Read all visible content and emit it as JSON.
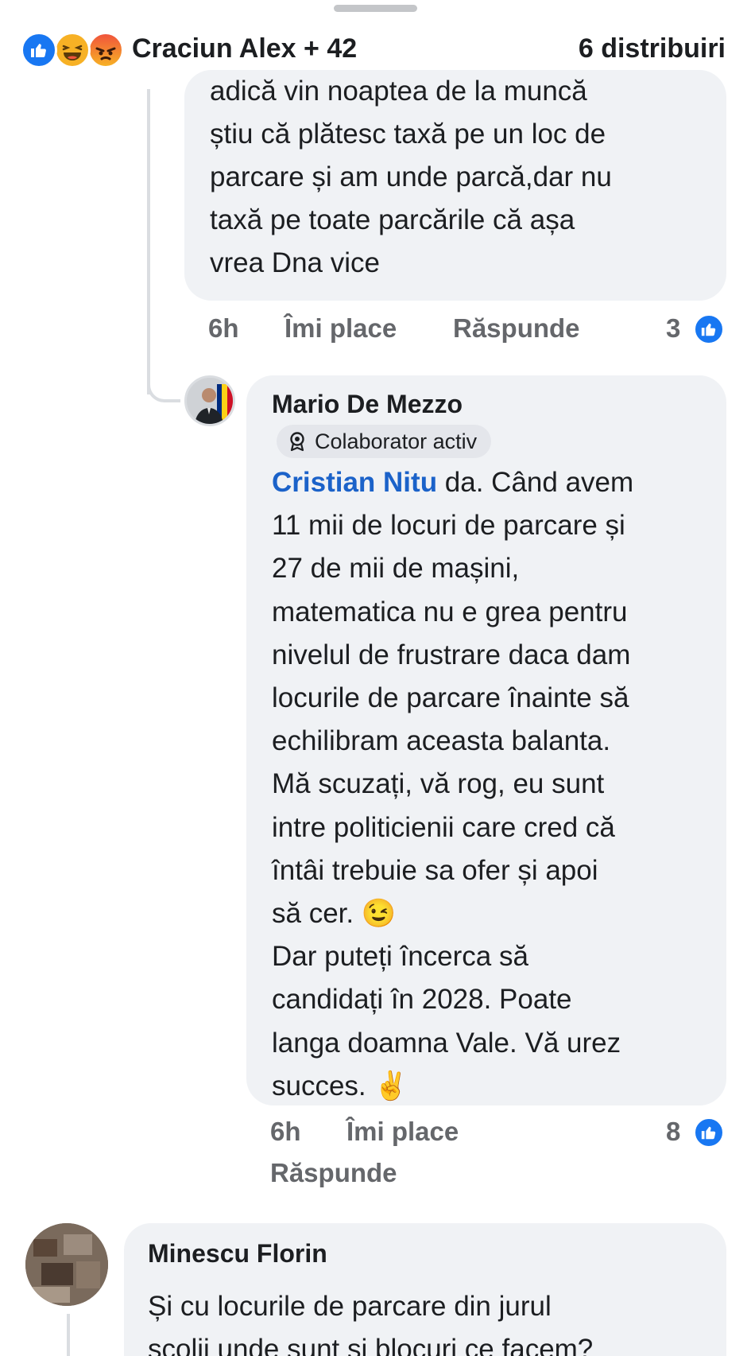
{
  "header": {
    "reaction_names": "Craciun Alex + 42",
    "shares": "6 distribuiri",
    "reaction_icons": [
      "like-icon",
      "haha-icon",
      "angry-icon"
    ],
    "colors": {
      "like": "#1877f2",
      "haha": "#f7b125",
      "angry": "#f0543c"
    }
  },
  "comment1": {
    "text": "adică vin noaptea de la muncă\nștiu că plătesc taxă pe un loc de\nparcare și am unde parcă,dar nu\ntaxă pe toate parcările că așa\nvrea Dna vice",
    "time": "6h",
    "like_label": "Îmi place",
    "reply_label": "Răspunde",
    "likes": "3"
  },
  "comment2": {
    "author": "Mario De Mezzo",
    "badge": "Colaborator activ",
    "mention": "Cristian Nitu",
    "text_first_line_rest": " da. Când avem",
    "text": "11 mii de locuri de parcare și\n27 de mii de mașini,\nmatematica nu e grea pentru\nnivelul de frustrare daca dam\nlocurile de parcare înainte să\nechilibram aceasta balanta.\nMă scuzați, vă rog, eu sunt\nintre politicienii care cred că\nîntâi trebuie sa ofer și apoi\nsă cer.",
    "wink_emoji": "😉",
    "text2": "Dar puteți încerca să\ncandidați în 2028. Poate\nlanga doamna Vale. Vă urez\nsucces.",
    "victory_emoji": "✌",
    "time": "6h",
    "like_label": "Îmi place",
    "reply_label": "Răspunde",
    "likes": "8"
  },
  "comment3": {
    "author": "Minescu Florin",
    "text": "Și cu locurile de parcare din jurul\nșcolii unde sunt și blocuri ce facem?"
  }
}
